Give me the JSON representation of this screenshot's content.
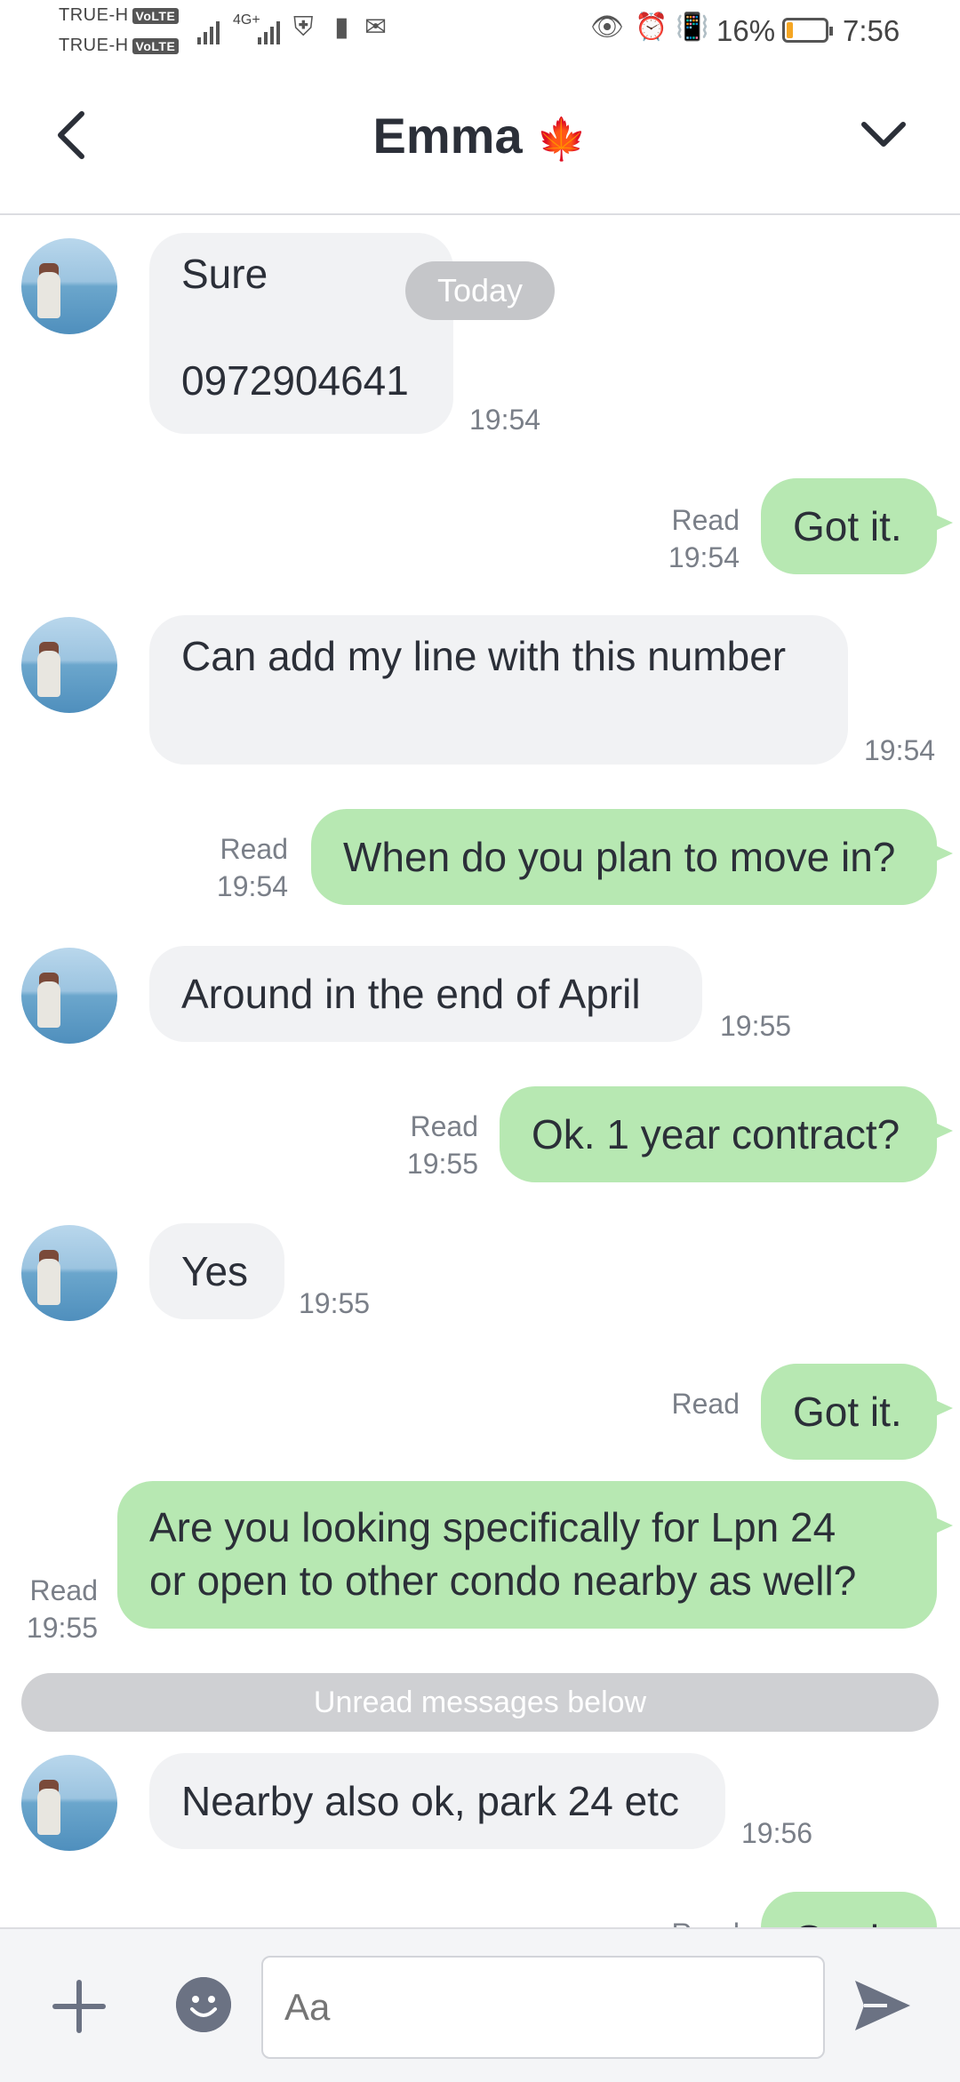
{
  "status_bar": {
    "carrier1": "TRUE-H",
    "carrier2": "TRUE-H",
    "volte": "VoLTE",
    "network": "4G+",
    "battery_percent": "16%",
    "battery_level": 0.16,
    "time": "7:56",
    "icons": [
      "signal-icon",
      "shield-icon",
      "battery-alert-icon",
      "gmail-icon",
      "eye-icon",
      "alarm-icon",
      "vibrate-icon"
    ]
  },
  "header": {
    "title": "Emma",
    "title_emoji": "🍁",
    "back_icon": "chevron-left-icon",
    "menu_icon": "chevron-down-icon"
  },
  "chat": {
    "date_pill": "Today",
    "unread_divider": "Unread messages below",
    "messages": [
      {
        "dir": "in",
        "lines": [
          "Sure",
          "",
          "0972904641"
        ],
        "time": "19:54"
      },
      {
        "dir": "out",
        "text": "Got it.",
        "read": "Read",
        "time": "19:54"
      },
      {
        "dir": "in",
        "text": "Can add my line with this number",
        "time": "19:54"
      },
      {
        "dir": "out",
        "text": "When do you plan to move in?",
        "read": "Read",
        "time": "19:54"
      },
      {
        "dir": "in",
        "text": "Around in the end of April",
        "time": "19:55"
      },
      {
        "dir": "out",
        "text": "Ok. 1 year contract?",
        "read": "Read",
        "time": "19:55"
      },
      {
        "dir": "in",
        "text": "Yes",
        "time": "19:55"
      },
      {
        "dir": "out",
        "text": "Got it.",
        "read": "Read",
        "time": ""
      },
      {
        "dir": "out",
        "lines": [
          "Are you looking specifically for Lpn 24",
          "or open to other condo nearby as well?"
        ],
        "read": "Read",
        "time": "19:55"
      },
      {
        "dir": "in",
        "text": "Nearby also ok, park 24 etc",
        "time": "19:56"
      },
      {
        "dir": "out",
        "text": "Got it.",
        "read": "Read",
        "time": ""
      }
    ]
  },
  "composer": {
    "placeholder": "Aa",
    "plus_icon": "plus-icon",
    "emoji_icon": "emoji-icon",
    "send_icon": "send-icon"
  }
}
